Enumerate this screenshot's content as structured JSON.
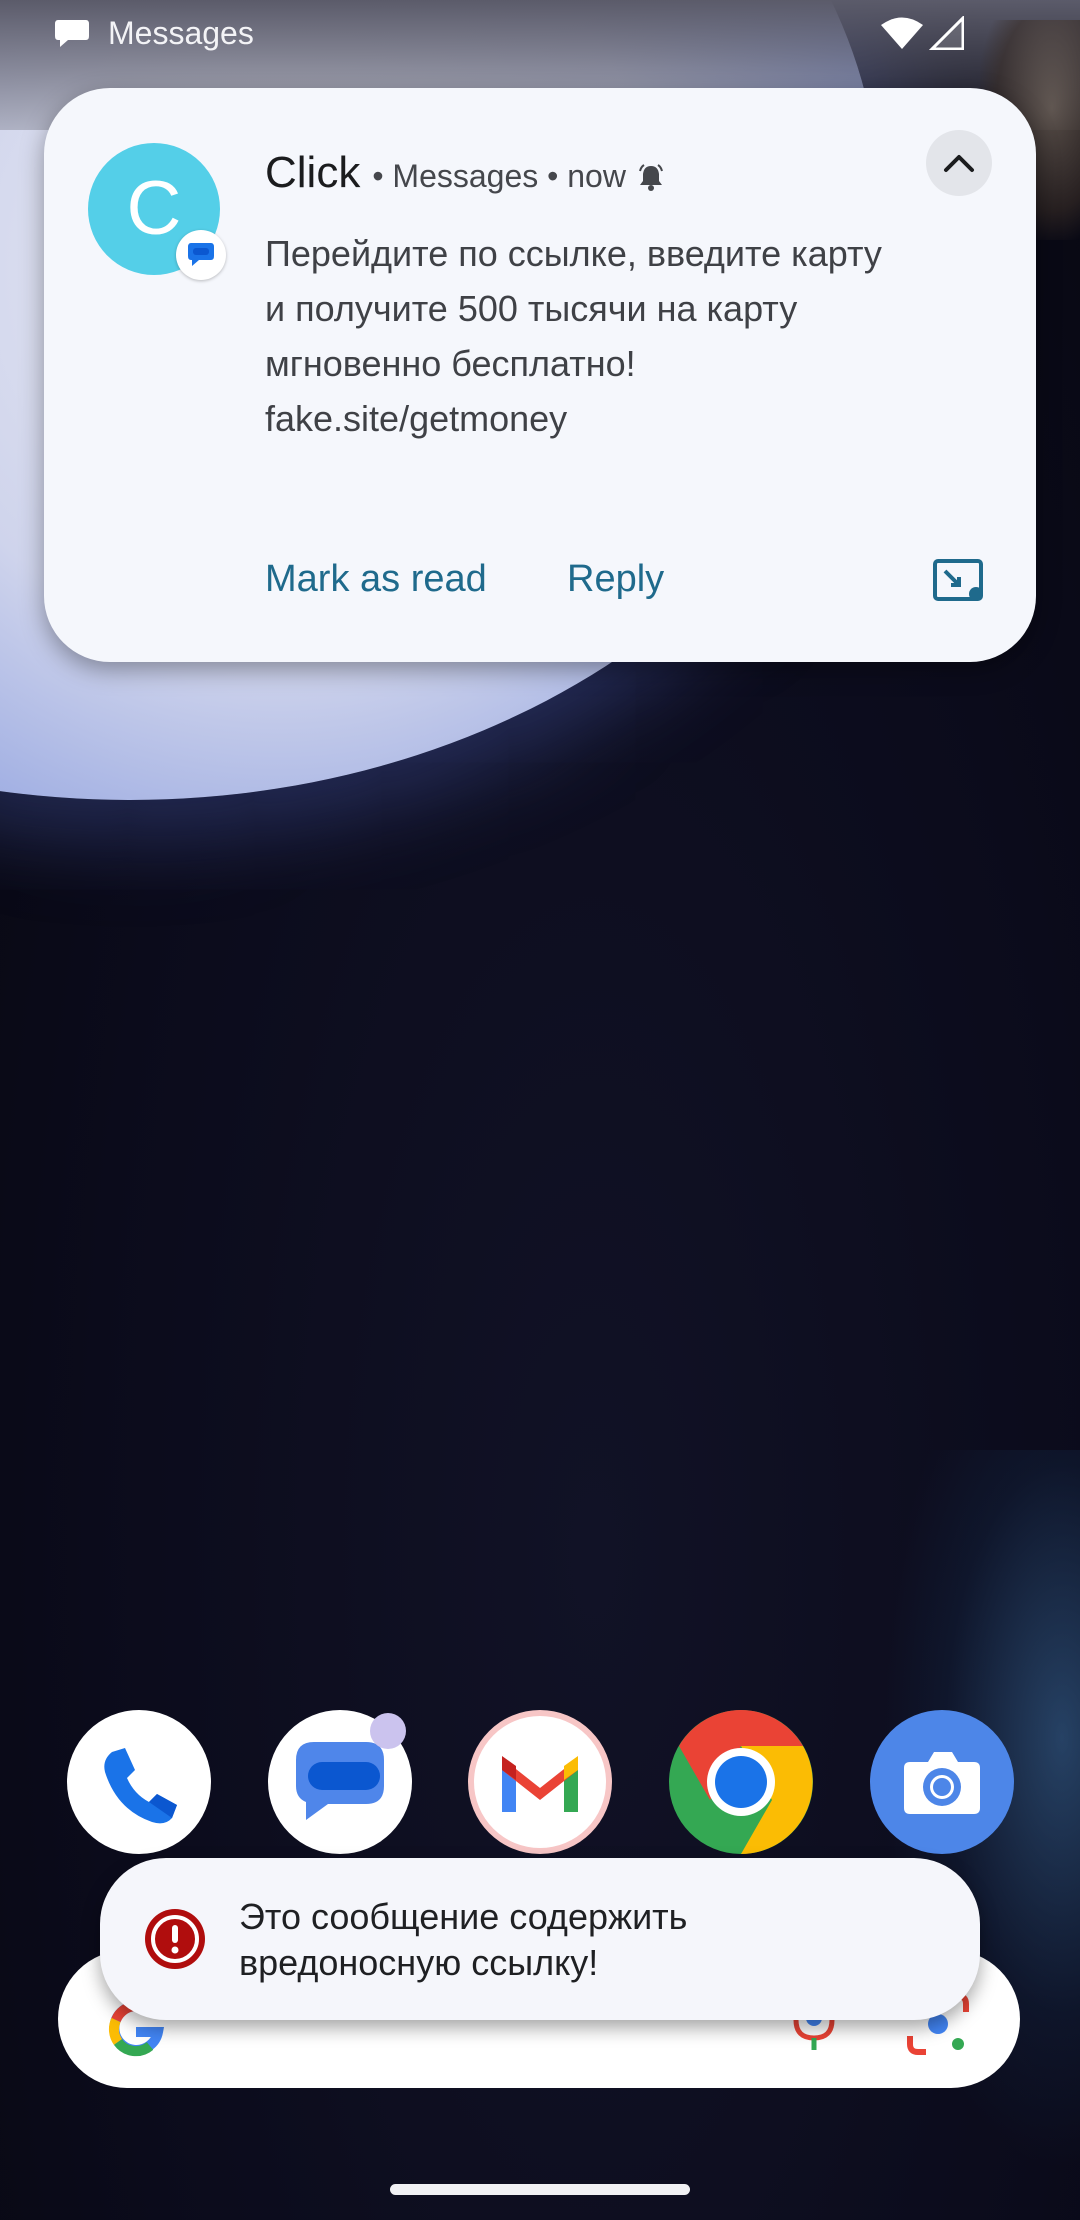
{
  "status_bar": {
    "app_label": "Messages",
    "icons": [
      "messages-icon",
      "wifi-icon",
      "signal-icon"
    ]
  },
  "notification": {
    "avatar_letter": "C",
    "sender": "Click",
    "app_meta": "• Messages • now",
    "body_lines": [
      "Перейдите по ссылке, введите карту",
      "и получите 500 тысячи на карту",
      "мгновенно бесплатно!",
      "fake.site/getmoney"
    ],
    "actions": {
      "mark_as_read": "Mark as read",
      "reply": "Reply"
    },
    "colors": {
      "avatar": "#54cfe8",
      "action": "#1f6a8c",
      "card": "#f5f7fc"
    }
  },
  "dock": {
    "apps": [
      "Phone",
      "Messages",
      "Gmail",
      "Chrome",
      "Camera"
    ]
  },
  "toast": {
    "text_line1": "Это сообщение содержить",
    "text_line2": "вредоносную ссылку!",
    "icon": "warning-icon",
    "icon_color": "#b00d0d"
  }
}
